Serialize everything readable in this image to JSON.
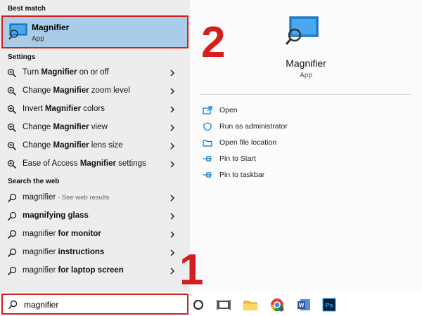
{
  "left_pane": {
    "best_match_header": "Best match",
    "best_match": {
      "title": "Magnifier",
      "subtitle": "App"
    },
    "settings_header": "Settings",
    "settings_items": [
      {
        "pre": "Turn ",
        "bold": "Magnifier",
        "post": " on or off"
      },
      {
        "pre": "Change ",
        "bold": "Magnifier",
        "post": " zoom level"
      },
      {
        "pre": "Invert ",
        "bold": "Magnifier",
        "post": " colors"
      },
      {
        "pre": "Change ",
        "bold": "Magnifier",
        "post": " view"
      },
      {
        "pre": "Change ",
        "bold": "Magnifier",
        "post": " lens size"
      },
      {
        "pre": "Ease of Access ",
        "bold": "Magnifier",
        "post": " settings"
      }
    ],
    "web_header": "Search the web",
    "web_items": [
      {
        "pre": "magnifier",
        "bold": "",
        "post": "",
        "muted": " - See web results"
      },
      {
        "pre": "",
        "bold": "magnifying glass",
        "post": "",
        "muted": ""
      },
      {
        "pre": "magnifier ",
        "bold": "for monitor",
        "post": "",
        "muted": ""
      },
      {
        "pre": "magnifier ",
        "bold": "instructions",
        "post": "",
        "muted": ""
      },
      {
        "pre": "magnifier ",
        "bold": "for laptop screen",
        "post": "",
        "muted": ""
      }
    ]
  },
  "search": {
    "value": "magnifier"
  },
  "right_pane": {
    "app_title": "Magnifier",
    "app_subtitle": "App",
    "actions": [
      {
        "label": "Open",
        "icon": "open-icon"
      },
      {
        "label": "Run as administrator",
        "icon": "run-as-admin-icon"
      },
      {
        "label": "Open file location",
        "icon": "file-location-icon"
      },
      {
        "label": "Pin to Start",
        "icon": "pin-icon"
      },
      {
        "label": "Pin to taskbar",
        "icon": "pin-icon"
      }
    ]
  },
  "annotations": {
    "step1": "1",
    "step2": "2"
  },
  "colors": {
    "highlight": "#a9cce8",
    "annotation_red": "#d41f1f",
    "accent_blue": "#0078d7"
  }
}
